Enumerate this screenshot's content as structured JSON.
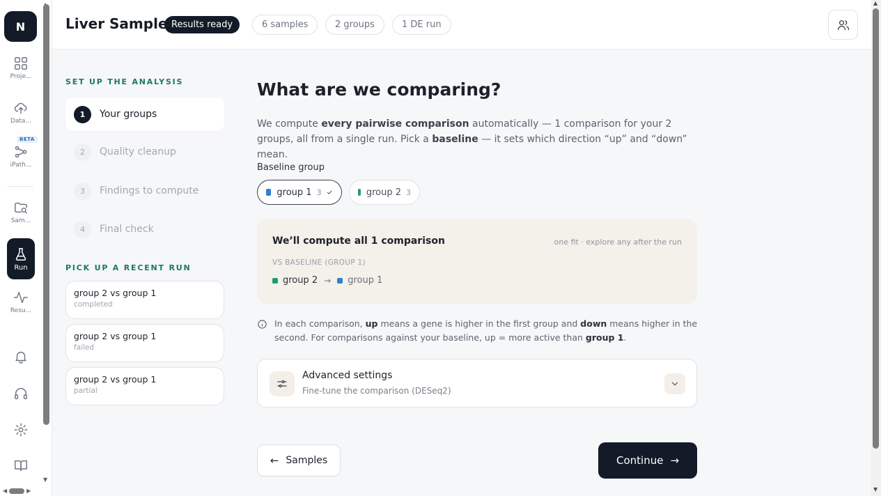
{
  "rail": {
    "logo": "N",
    "items": [
      {
        "label": "Proje...",
        "icon": "grid-icon"
      },
      {
        "label": "Data...",
        "icon": "cloud-upload-icon"
      },
      {
        "label": "iPath...",
        "icon": "pathway-icon",
        "badge": "BETA"
      },
      {
        "label": "Sam...",
        "icon": "folder-search-icon"
      },
      {
        "label": "Run",
        "icon": "flask-icon",
        "active": true
      },
      {
        "label": "Resu...",
        "icon": "pulse-icon"
      }
    ],
    "bottom_icons": [
      "bell-icon",
      "headset-icon",
      "gear-icon",
      "book-icon"
    ]
  },
  "header": {
    "title": "Liver Sample",
    "status": "Results ready",
    "pills": [
      "6 samples",
      "2 groups",
      "1 DE run"
    ],
    "right_icon": "people-icon"
  },
  "setup": {
    "section_title": "SET UP THE ANALYSIS",
    "steps": [
      {
        "num": "1",
        "label": "Your groups",
        "active": true
      },
      {
        "num": "2",
        "label": "Quality cleanup"
      },
      {
        "num": "3",
        "label": "Findings to compute"
      },
      {
        "num": "4",
        "label": "Final check"
      }
    ]
  },
  "recent": {
    "section_title": "PICK UP A RECENT RUN",
    "runs": [
      {
        "name": "group 2 vs group 1",
        "status": "completed"
      },
      {
        "name": "group 2 vs group 1",
        "status": "failed"
      },
      {
        "name": "group 2 vs group 1",
        "status": "partial"
      }
    ]
  },
  "main": {
    "title": "What are we comparing?",
    "lead_1": "We compute ",
    "lead_bold_1": "every pairwise comparison",
    "lead_2": " automatically — 1 comparison for your 2 groups, all from a single run. Pick a ",
    "lead_bold_2": "baseline",
    "lead_3": " — it sets which direction “up” and “down” mean.",
    "baseline_label": "Baseline group",
    "groups": [
      {
        "name": "group 1",
        "count": "3",
        "color": "#2f80d1",
        "selected": true
      },
      {
        "name": "group 2",
        "count": "3",
        "color": "#1f9d6b",
        "selected": false
      }
    ],
    "summary": {
      "title": "We’ll compute all 1 comparison",
      "note": "one fit · explore any after the run",
      "sub": "VS BASELINE (GROUP 1)",
      "from": "group 2",
      "to": "group 1"
    },
    "info_1": "In each comparison, ",
    "info_up": "up",
    "info_2": " means a gene is higher in the first group and ",
    "info_down": "down",
    "info_3": " means higher in the second. For comparisons against your baseline, up = more active than ",
    "info_group": "group 1",
    "info_4": ".",
    "advanced": {
      "title": "Advanced settings",
      "subtitle": "Fine-tune the comparison (DESeq2)"
    },
    "back_label": "Samples",
    "continue_label": "Continue"
  },
  "colors": {
    "dark": "#131b28",
    "accent_green": "#1c7a59",
    "group_1": "#2f80d1",
    "group_2": "#1f9d6b"
  }
}
